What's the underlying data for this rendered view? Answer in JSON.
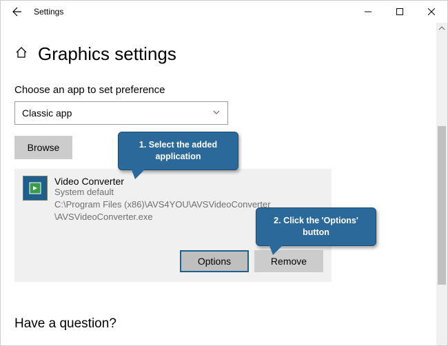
{
  "window": {
    "title": "Settings"
  },
  "header": {
    "title": "Graphics settings"
  },
  "section": {
    "label": "Choose an app to set preference",
    "dropdown_value": "Classic app",
    "browse_label": "Browse"
  },
  "app": {
    "name": "Video Converter",
    "default_text": "System default",
    "path_line1": "C:\\Program Files (x86)\\AVS4YOU\\AVSVideoConverter",
    "path_line2": "\\AVSVideoConverter.exe",
    "options_label": "Options",
    "remove_label": "Remove"
  },
  "footer": {
    "question": "Have a question?"
  },
  "callouts": {
    "c1_line1": "1. Select the added",
    "c1_line2": "application",
    "c2_line1": "2. Click the 'Options'",
    "c2_line2": "button"
  }
}
